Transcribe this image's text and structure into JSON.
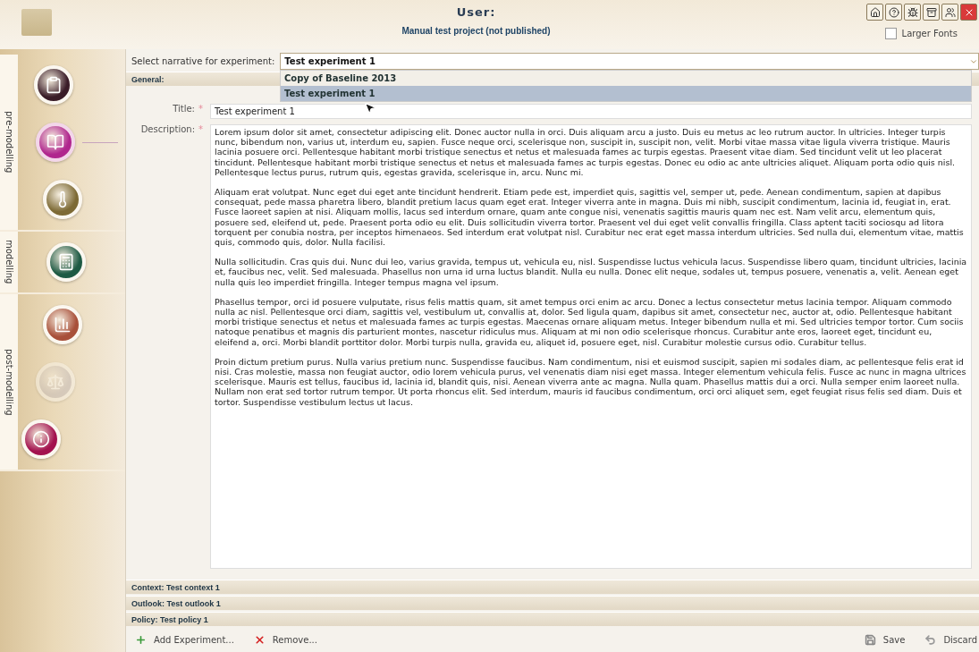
{
  "header": {
    "title": "User:",
    "subtitle": "Manual test project (not published)",
    "toolbar": [
      {
        "kind": "home"
      },
      {
        "kind": "help"
      },
      {
        "kind": "bug"
      },
      {
        "kind": "archive"
      },
      {
        "kind": "users"
      },
      {
        "kind": "close"
      }
    ],
    "larger_fonts": {
      "label": "Larger Fonts",
      "checked": false
    }
  },
  "sidebar": {
    "sections": [
      {
        "label": "pre-modelling",
        "items": [
          {
            "kind": "clipboard",
            "selected": false,
            "disabled": false
          },
          {
            "kind": "books",
            "selected": true,
            "disabled": false
          },
          {
            "kind": "thermometer",
            "selected": false,
            "disabled": false
          }
        ]
      },
      {
        "label": "modelling",
        "items": [
          {
            "kind": "calculator",
            "selected": false,
            "disabled": false
          }
        ]
      },
      {
        "label": "post-modelling",
        "items": [
          {
            "kind": "chart",
            "selected": false,
            "disabled": false
          },
          {
            "kind": "scales",
            "selected": false,
            "disabled": true
          },
          {
            "kind": "info",
            "selected": false,
            "disabled": false
          }
        ]
      }
    ]
  },
  "narrative": {
    "label": "Select narrative for experiment:",
    "value": "Test experiment 1",
    "expanded": true,
    "options": [
      {
        "label": "Copy of Baseline 2013",
        "selected": false
      },
      {
        "label": "Test experiment 1",
        "selected": true
      }
    ]
  },
  "general": {
    "heading": "General:",
    "title_label": "Title:",
    "title_mark": "*",
    "description_mark": "*",
    "title_value": "Test experiment 1",
    "description_label": "Description:",
    "description": [
      "Lorem ipsum dolor sit amet, consectetur adipiscing elit. Donec auctor nulla in orci. Duis aliquam arcu a justo. Duis eu metus ac leo rutrum auctor. In ultricies. Integer turpis nunc, bibendum non, varius ut, interdum eu, sapien. Fusce neque orci, scelerisque non, suscipit in, suscipit non, velit. Morbi vitae massa vitae ligula viverra tristique. Mauris lacinia posuere orci. Pellentesque habitant morbi tristique senectus et netus et malesuada fames ac turpis egestas. Praesent vitae diam. Sed tincidunt velit ut leo placerat tincidunt. Pellentesque habitant morbi tristique senectus et netus et malesuada fames ac turpis egestas. Donec eu odio ac ante ultricies aliquet. Aliquam porta odio quis nisl. Pellentesque lectus purus, rutrum quis, egestas gravida, scelerisque in, arcu. Nunc mi.",
      "Aliquam erat volutpat. Nunc eget dui eget ante tincidunt hendrerit. Etiam pede est, imperdiet quis, sagittis vel, semper ut, pede. Aenean condimentum, sapien at dapibus consequat, pede massa pharetra libero, blandit pretium lacus quam eget erat. Integer viverra ante in magna. Duis mi nibh, suscipit condimentum, lacinia id, feugiat in, erat. Fusce laoreet sapien at nisi. Aliquam mollis, lacus sed interdum ornare, quam ante congue nisi, venenatis sagittis mauris quam nec est. Nam velit arcu, elementum quis, posuere sed, eleifend ut, pede. Praesent porta odio eu elit. Duis sollicitudin viverra tortor. Praesent vel dui eget velit convallis fringilla. Class aptent taciti sociosqu ad litora torquent per conubia nostra, per inceptos himenaeos. Sed interdum erat volutpat nisl. Curabitur nec erat eget massa interdum ultricies. Sed nulla dui, elementum vitae, mattis quis, commodo quis, dolor. Nulla facilisi.",
      "Nulla sollicitudin. Cras quis dui. Nunc dui leo, varius gravida, tempus ut, vehicula eu, nisl. Suspendisse luctus vehicula lacus. Suspendisse libero quam, tincidunt ultricies, lacinia et, faucibus nec, velit. Sed malesuada. Phasellus non urna id urna luctus blandit. Nulla eu nulla. Donec elit neque, sodales ut, tempus posuere, venenatis a, velit. Aenean eget nulla quis leo imperdiet fringilla. Integer tempus magna vel ipsum.",
      "Phasellus tempor, orci id posuere vulputate, risus felis mattis quam, sit amet tempus orci enim ac arcu. Donec a lectus consectetur metus lacinia tempor. Aliquam commodo nulla ac nisl. Pellentesque orci diam, sagittis vel, vestibulum ut, convallis at, dolor. Sed ligula quam, dapibus sit amet, consectetur nec, auctor at, odio. Pellentesque habitant morbi tristique senectus et netus et malesuada fames ac turpis egestas. Maecenas ornare aliquam metus. Integer bibendum nulla et mi. Sed ultricies tempor tortor. Cum sociis natoque penatibus et magnis dis parturient montes, nascetur ridiculus mus. Aliquam at mi non odio scelerisque rhoncus. Curabitur ante eros, laoreet eget, tincidunt eu, eleifend a, orci. Morbi blandit porttitor dolor. Morbi turpis nulla, gravida eu, aliquet id, posuere eget, nisl. Curabitur molestie cursus odio. Curabitur tellus.",
      "Proin dictum pretium purus. Nulla varius pretium nunc. Suspendisse faucibus. Nam condimentum, nisi et euismod suscipit, sapien mi sodales diam, ac pellentesque felis erat id nisi. Cras molestie, massa non feugiat auctor, odio lorem vehicula purus, vel venenatis diam nisi eget massa. Integer elementum vehicula felis. Fusce ac nunc in magna ultrices scelerisque. Mauris est tellus, faucibus id, lacinia id, blandit quis, nisi. Aenean viverra ante ac magna. Nulla quam. Phasellus mattis dui a orci. Nulla semper enim laoreet nulla. Nullam non erat sed tortor rutrum tempor. Ut porta rhoncus elit. Sed interdum, mauris id faucibus condimentum, orci orci aliquet sem, eget feugiat risus felis sed diam. Duis et tortor. Suspendisse vestibulum lectus ut lacus."
    ]
  },
  "sections": [
    "Context: Test context 1",
    "Outlook: Test outlook 1",
    "Policy: Test policy 1"
  ],
  "actions": [
    {
      "kind": "add",
      "label": "Add Experiment..."
    },
    {
      "kind": "remove",
      "label": "Remove..."
    },
    {
      "kind": "save",
      "label": "Save"
    },
    {
      "kind": "discard",
      "label": "Discard"
    }
  ]
}
